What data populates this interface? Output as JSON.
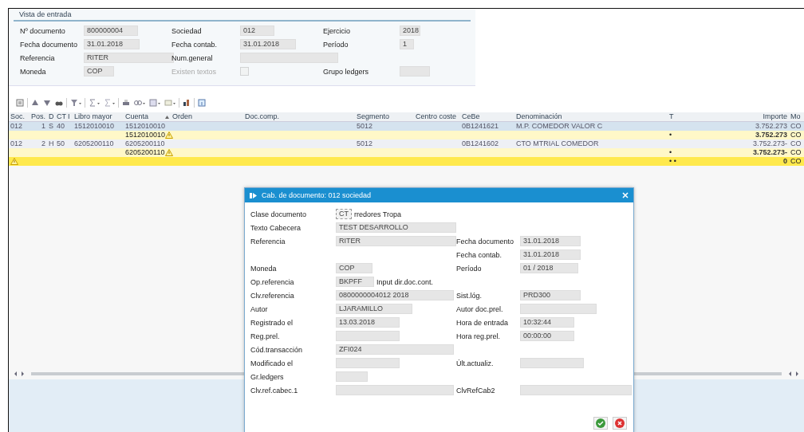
{
  "entry_view": {
    "title": "Vista de entrada",
    "fields": [
      {
        "label": "Nº documento",
        "value": "800000004"
      },
      {
        "label": "Sociedad",
        "value": "012"
      },
      {
        "label": "Ejercicio",
        "value": "2018"
      },
      {
        "label": "Fecha documento",
        "value": "31.01.2018"
      },
      {
        "label": "Fecha contab.",
        "value": "31.01.2018"
      },
      {
        "label": "Período",
        "value": "1"
      },
      {
        "label": "Referencia",
        "value": "RITER"
      },
      {
        "label": "Num.general"
      },
      {
        "kind": "blank"
      },
      {
        "label": "Moneda",
        "value": "COP"
      },
      {
        "label": "Existen textos",
        "kind": "checkbox",
        "checked": false,
        "disabled": true
      },
      {
        "label": "Grupo ledgers"
      }
    ]
  },
  "table": {
    "columns": [
      {
        "label": "Soc."
      },
      {
        "label": "Pos."
      },
      {
        "label": "D"
      },
      {
        "label": "CT"
      },
      {
        "label": "I"
      },
      {
        "label": "Libro mayor"
      },
      {
        "label": "Cuenta"
      },
      {
        "label": "Orden",
        "sorted": true
      },
      {
        "label": "Doc.comp."
      },
      {
        "label": "Segmento"
      },
      {
        "label": "Centro coste"
      },
      {
        "label": "CeBe"
      },
      {
        "label": "Denominación"
      },
      {
        "label": "T"
      },
      {
        "label": "Importe"
      },
      {
        "label": "Mo"
      }
    ],
    "rows": [
      {
        "kind": "item",
        "selected": true,
        "cells": [
          "012",
          "1",
          "S",
          "40",
          null,
          "1512010010",
          "1512010010",
          null,
          null,
          "5012",
          null,
          "0B1241621",
          "M.P. COMEDOR VALOR C",
          null,
          "3.752.273",
          "CO"
        ]
      },
      {
        "kind": "subtotal",
        "selected": false,
        "warning": true,
        "cells": [
          null,
          null,
          null,
          null,
          null,
          null,
          "1512010010",
          null,
          null,
          null,
          null,
          null,
          null,
          "•",
          "3.752.273",
          "CO"
        ]
      },
      {
        "kind": "item",
        "selected": false,
        "cells": [
          "012",
          "2",
          "H",
          "50",
          null,
          "6205200110",
          "6205200110",
          null,
          null,
          "5012",
          null,
          "0B1241602",
          "CTO MTRIAL COMEDOR",
          null,
          "3.752.273-",
          "CO"
        ]
      },
      {
        "kind": "subtotal",
        "selected": false,
        "warning": true,
        "cells": [
          null,
          null,
          null,
          null,
          null,
          null,
          "6205200110",
          null,
          null,
          null,
          null,
          null,
          null,
          "•",
          "3.752.273-",
          "CO"
        ]
      },
      {
        "kind": "total",
        "selected": false,
        "warning": true,
        "cells": [
          null,
          null,
          null,
          null,
          null,
          null,
          null,
          null,
          null,
          null,
          null,
          null,
          null,
          "• •",
          "0",
          "CO"
        ]
      }
    ]
  },
  "dialog": {
    "title": "Cab. de documento: 012 sociedad",
    "rows": [
      {
        "left": {
          "label": "Clase documento",
          "value": "CT",
          "kind": "dropdown",
          "description": "rredores Tropa"
        }
      },
      {
        "left": {
          "label": "Texto Cabecera",
          "value": "TEST DESARROLLO"
        }
      },
      {
        "left": {
          "label": "Referencia",
          "value": "RITER"
        },
        "right": {
          "label": "Fecha documento",
          "value": "31.01.2018"
        }
      },
      {
        "right": {
          "label": "Fecha contab.",
          "value": "31.01.2018"
        }
      },
      {
        "left": {
          "label": "Moneda",
          "value": "COP"
        },
        "right": {
          "label": "Período",
          "value": "01 / 2018"
        }
      },
      {
        "left": {
          "label": "Op.referencia",
          "value": "BKPFF",
          "description": "Input dir.doc.cont."
        }
      },
      {
        "left": {
          "label": "Clv.referencia",
          "value": "0800000004012 2018"
        },
        "right": {
          "label": "Sist.lóg.",
          "value": "PRD300"
        }
      },
      {
        "left": {
          "label": "Autor",
          "value": "LJARAMILLO"
        },
        "right": {
          "label": "Autor doc.prel."
        }
      },
      {
        "left": {
          "label": "Registrado el",
          "value": "13.03.2018"
        },
        "right": {
          "label": "Hora de entrada",
          "value": "10:32:44"
        }
      },
      {
        "left": {
          "label": "Reg.prel."
        },
        "right": {
          "label": "Hora reg.prel.",
          "value": "00:00:00"
        }
      },
      {
        "left": {
          "label": "Cód.transacción",
          "value": "ZFI024"
        }
      },
      {
        "left": {
          "label": "Modificado el"
        },
        "right": {
          "label": "Últ.actualiz."
        }
      },
      {
        "left": {
          "label": "Gr.ledgers"
        }
      },
      {
        "left": {
          "label": "Clv.ref.cabec.1"
        },
        "right": {
          "label": "ClvRefCab2"
        }
      }
    ]
  }
}
